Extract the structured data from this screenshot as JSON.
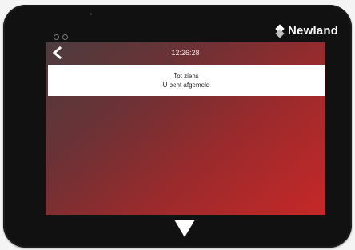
{
  "device": {
    "brand": "Newland"
  },
  "screen": {
    "time": "12:26:28",
    "message": {
      "line1": "Tot ziens",
      "line2": "U bent afgemeld"
    }
  },
  "icons": {
    "back": "chevron-left-icon",
    "nav": "triangle-down-icon"
  }
}
